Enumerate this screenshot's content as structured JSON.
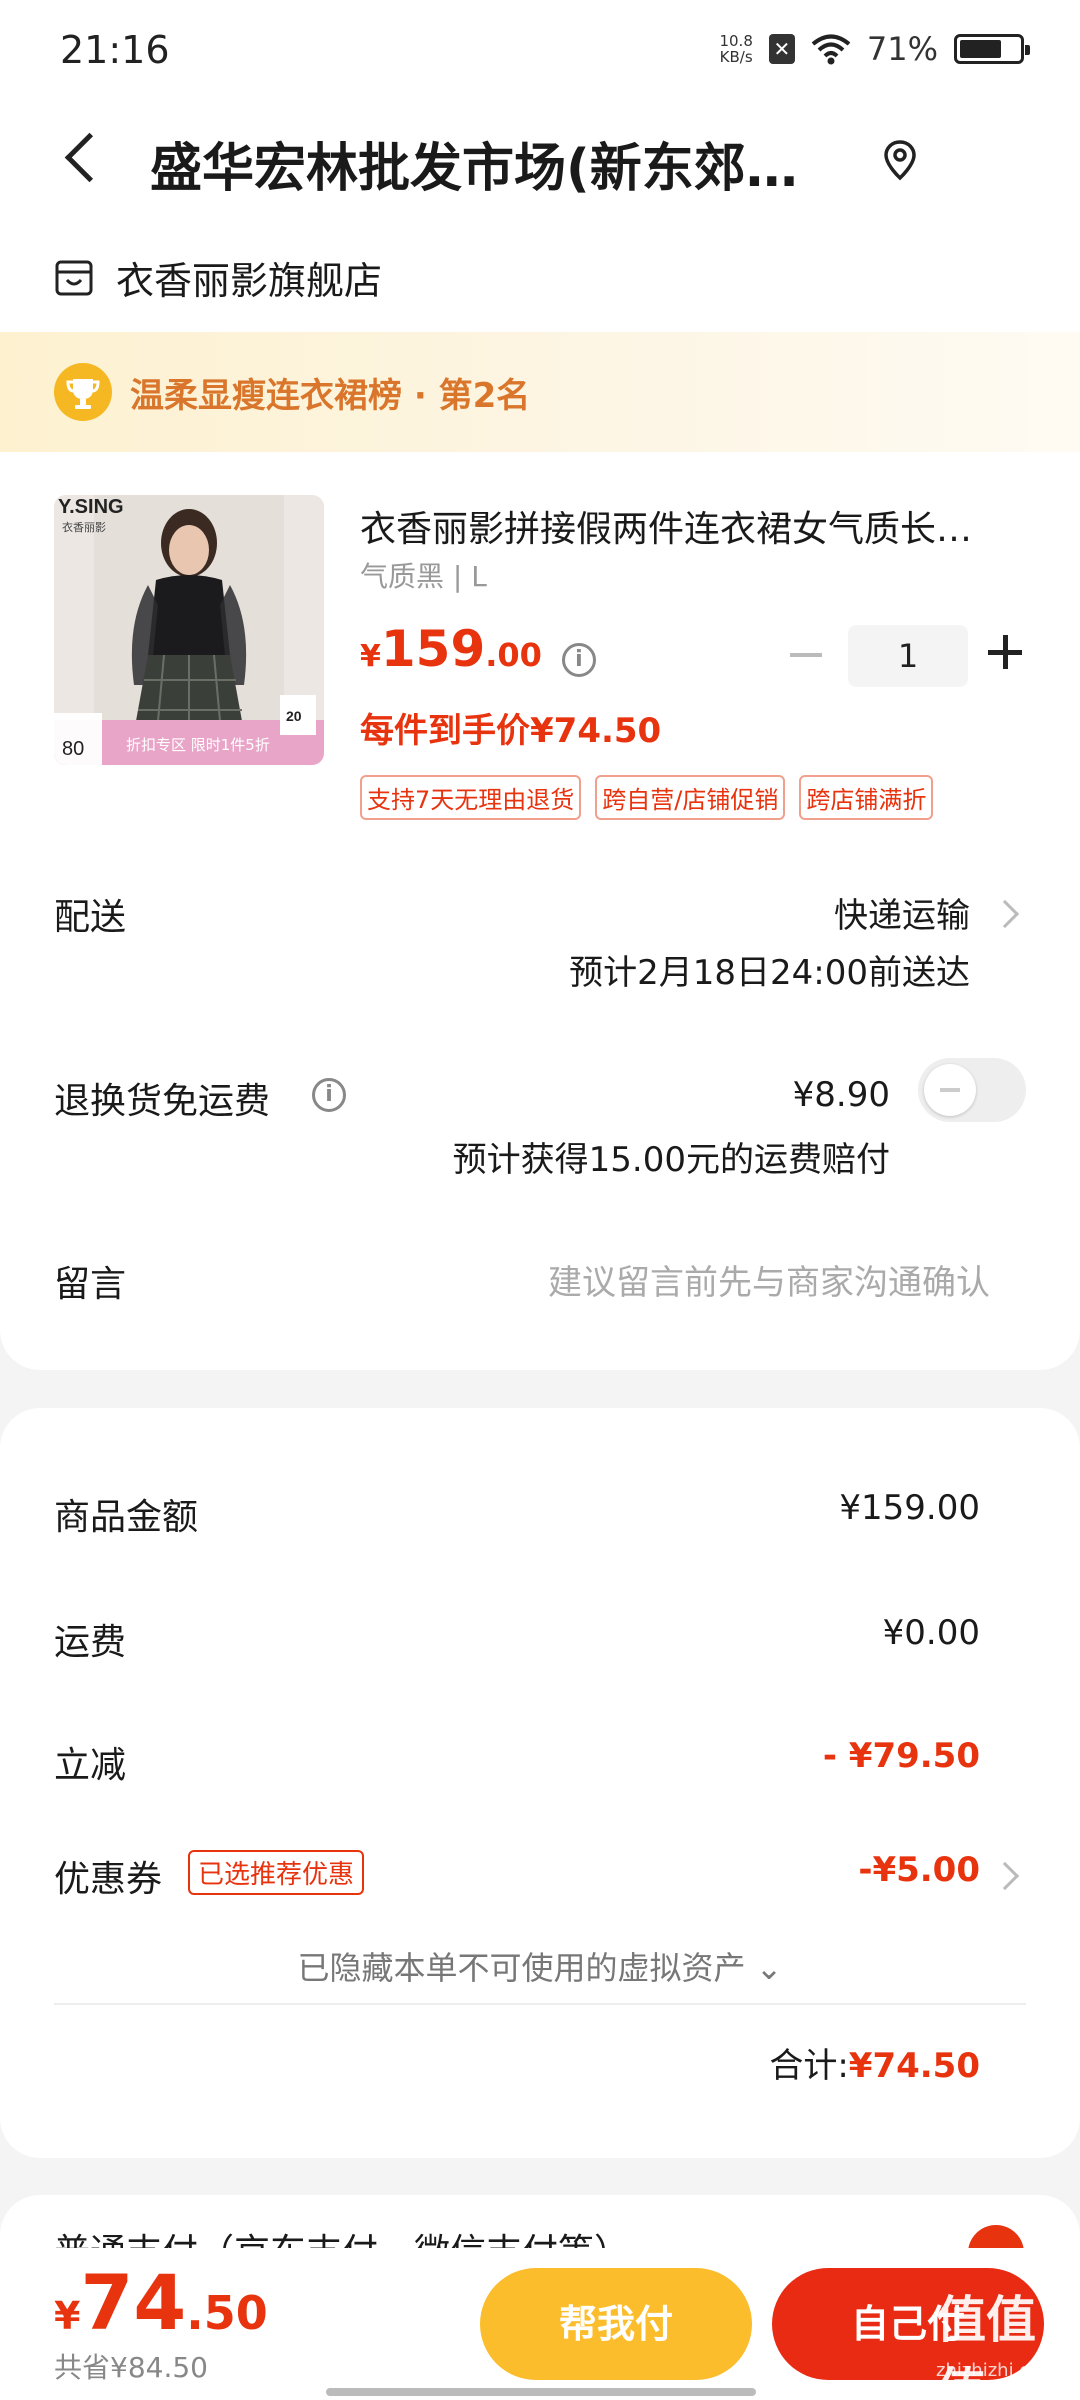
{
  "status": {
    "time": "21:16",
    "net_speed_top": "10.8",
    "net_speed_bottom": "KB/s",
    "battery": "71%",
    "battery_level": 0.71
  },
  "header": {
    "title": "盛华宏林批发市场(新东郊…"
  },
  "store": {
    "name": "衣香丽影旗舰店"
  },
  "rank": {
    "text": "温柔显瘦连衣裙榜 · 第2名"
  },
  "product": {
    "image_brand": "Y.SING",
    "image_brand_cn": "衣香丽影",
    "image_badge_num": "80",
    "image_badge_20": "20",
    "image_banner": "折扣专区 限时1件5折",
    "name": "衣香丽影拼接假两件连衣裙女气质长…",
    "spec": "气质黑 | L",
    "price_symbol": "¥",
    "price_int": "159",
    "price_dec": ".00",
    "quantity": "1",
    "unit_price": "每件到手价¥74.50",
    "tags": [
      "支持7天无理由退货",
      "跨自营/店铺促销",
      "跨店铺满折"
    ]
  },
  "delivery": {
    "label": "配送",
    "method": "快递运输",
    "eta": "预计2月18日24:00前送达"
  },
  "return_shipping": {
    "label": "退换货免运费",
    "price": "¥8.90",
    "note": "预计获得15.00元的运费赔付",
    "enabled": false
  },
  "message": {
    "label": "留言",
    "placeholder": "建议留言前先与商家沟通确认"
  },
  "summary": {
    "goods_label": "商品金额",
    "goods_value": "¥159.00",
    "shipping_label": "运费",
    "shipping_value": "¥0.00",
    "discount_label": "立减",
    "discount_value": "- ¥79.50",
    "coupon_label": "优惠券",
    "coupon_tag": "已选推荐优惠",
    "coupon_value": "-¥5.00",
    "hidden_assets": "已隐藏本单不可使用的虚拟资产 ⌄",
    "total_label": "合计:",
    "total_value": "¥74.50"
  },
  "payment": {
    "title": "普通支付（京东支付、微信支付等）"
  },
  "bottom": {
    "price_symbol": "¥",
    "price_int": "74",
    "price_dec": ".50",
    "saved": "共省¥84.50",
    "help_pay": "帮我付",
    "self_pay": "自己付"
  },
  "watermark": {
    "main": "值值值",
    "sub": "zhizhizhi.com"
  },
  "colors": {
    "accent_red": "#e8330f",
    "help_yellow": "#fcbd2c",
    "pay_red": "#ea2b14",
    "rank_orange": "#d9762b"
  }
}
